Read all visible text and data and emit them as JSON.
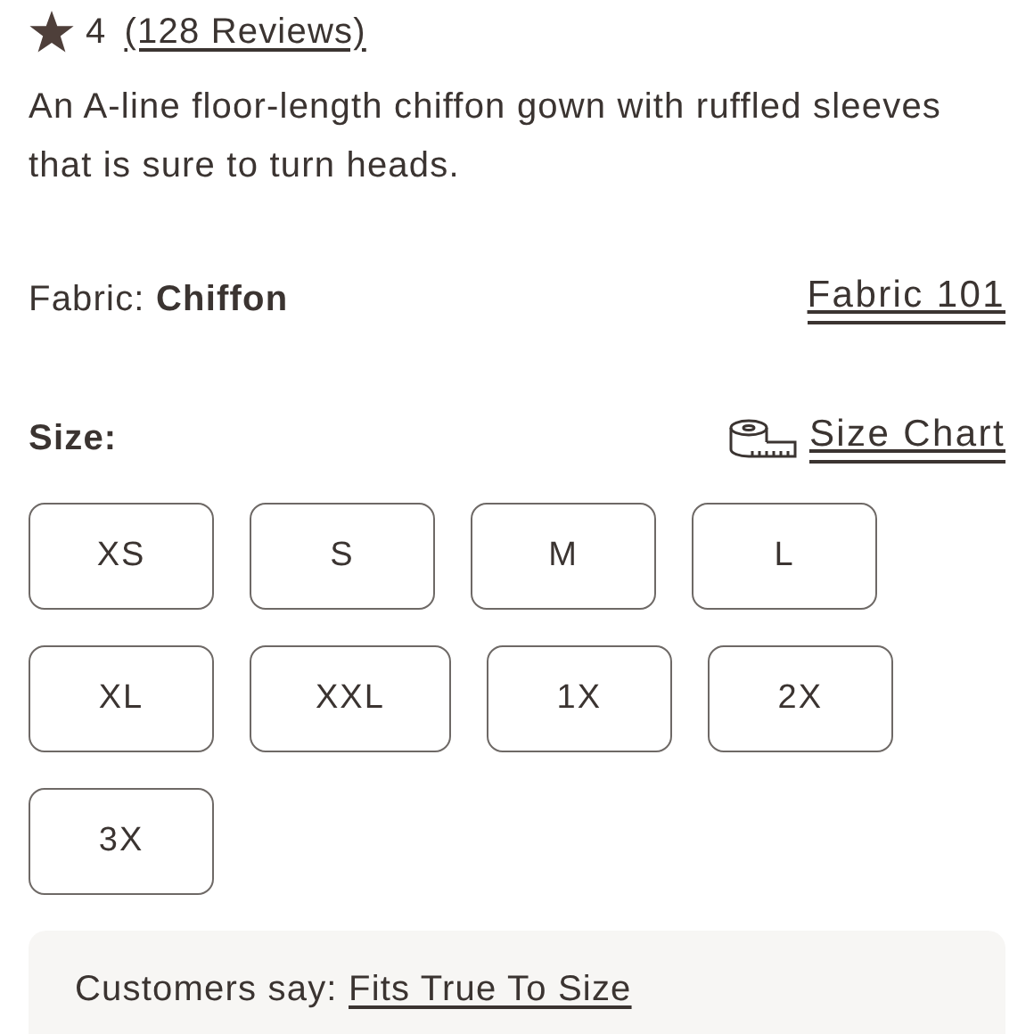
{
  "rating": {
    "value": "4",
    "reviews_link": "(128 Reviews)"
  },
  "description": "An A-line floor-length chiffon gown with ruffled sleeves that is sure to turn heads.",
  "fabric": {
    "label": "Fabric:",
    "value": "Chiffon",
    "link": "Fabric 101"
  },
  "size": {
    "label": "Size:",
    "chart_link": "Size Chart",
    "rows": [
      [
        {
          "label": "XS",
          "selected": false
        },
        {
          "label": "S",
          "selected": false
        },
        {
          "label": "M",
          "selected": false
        },
        {
          "label": "L",
          "selected": false
        }
      ],
      [
        {
          "label": "XL",
          "selected": false
        },
        {
          "label": "XXL",
          "selected": false
        },
        {
          "label": "1X",
          "selected": false
        },
        {
          "label": "2X",
          "selected": false
        }
      ],
      [
        {
          "label": "3X",
          "selected": false
        }
      ]
    ]
  },
  "fit": {
    "label": "Customers say:",
    "value": "Fits True To Size"
  }
}
